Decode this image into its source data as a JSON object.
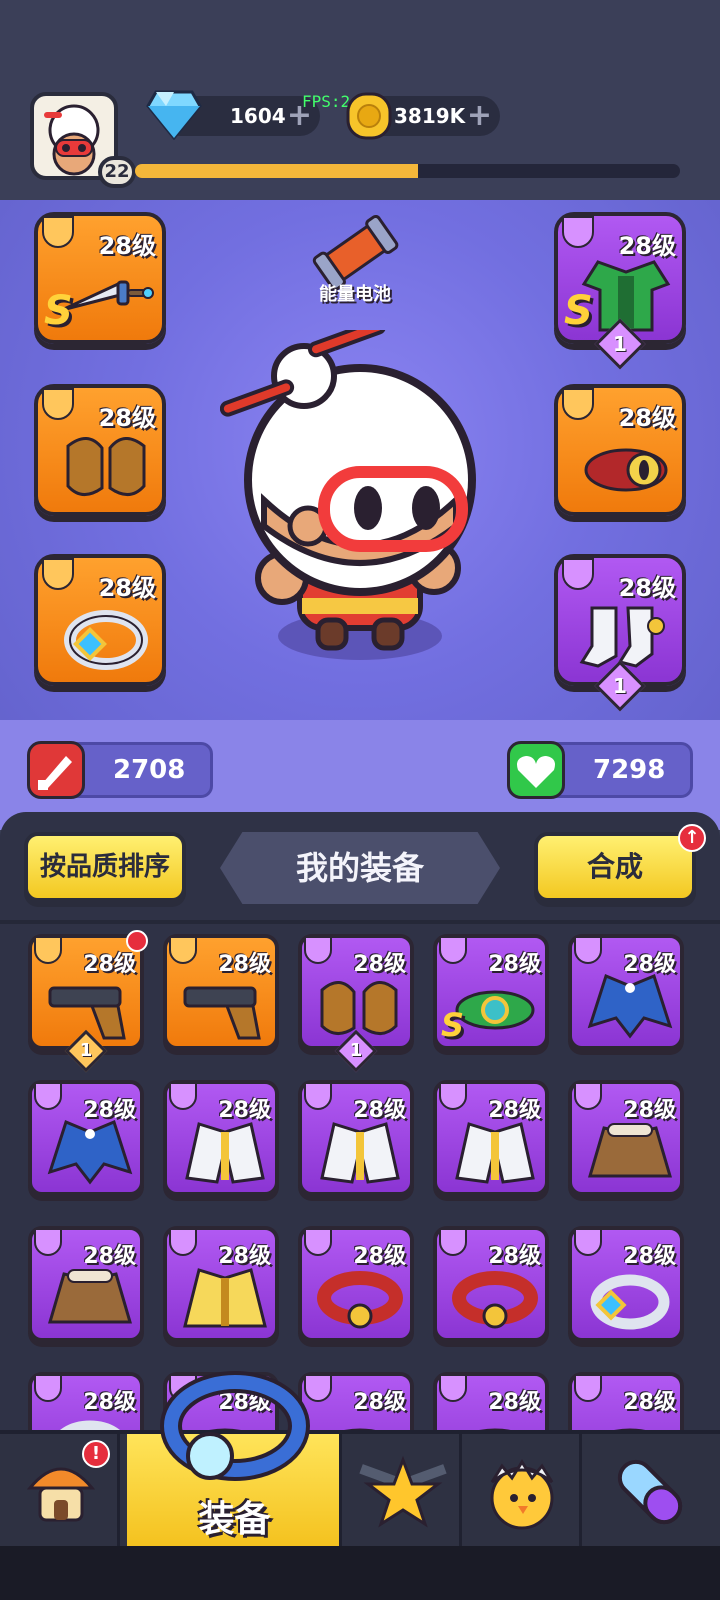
{
  "top_bar": {
    "player_level": "22",
    "gems": "1604",
    "coins": "3819K",
    "plus_symbol": "+",
    "fps_label": "FPS:24",
    "xp_progress": 0.52
  },
  "character_panel": {
    "battery_label": "能量电池",
    "slots": [
      {
        "level": "28级",
        "rarity": "orange",
        "rank": "S",
        "count": "",
        "icon": "sword-icon"
      },
      {
        "level": "28级",
        "rarity": "purple",
        "rank": "S",
        "count": "1",
        "icon": "armor-icon"
      },
      {
        "level": "28级",
        "rarity": "orange",
        "rank": "",
        "count": "",
        "icon": "gloves-icon"
      },
      {
        "level": "28级",
        "rarity": "orange",
        "rank": "",
        "count": "",
        "icon": "belt-icon"
      },
      {
        "level": "28级",
        "rarity": "orange",
        "rank": "",
        "count": "",
        "icon": "ring-icon"
      },
      {
        "level": "28级",
        "rarity": "purple",
        "rank": "",
        "count": "1",
        "icon": "boots-icon"
      }
    ],
    "attack": "2708",
    "health": "7298"
  },
  "inventory": {
    "sort_button": "按品质排序",
    "title": "我的装备",
    "merge_button": "合成",
    "merge_badge": "↑",
    "items": [
      {
        "level": "28级",
        "rarity": "orange",
        "rank": "",
        "count": "1",
        "icon": "gun-icon",
        "new": true
      },
      {
        "level": "28级",
        "rarity": "orange",
        "rank": "",
        "count": "",
        "icon": "gun-icon",
        "new": false
      },
      {
        "level": "28级",
        "rarity": "purple",
        "rank": "",
        "count": "1",
        "icon": "gloves-icon",
        "new": false
      },
      {
        "level": "28级",
        "rarity": "purple",
        "rank": "S",
        "count": "",
        "icon": "belt-icon",
        "new": false
      },
      {
        "level": "28级",
        "rarity": "purple",
        "rank": "",
        "count": "",
        "icon": "blue-coat-icon",
        "new": false
      },
      {
        "level": "28级",
        "rarity": "purple",
        "rank": "",
        "count": "",
        "icon": "blue-coat-icon",
        "new": false
      },
      {
        "level": "28级",
        "rarity": "purple",
        "rank": "",
        "count": "",
        "icon": "white-coat-icon",
        "new": false
      },
      {
        "level": "28级",
        "rarity": "purple",
        "rank": "",
        "count": "",
        "icon": "white-coat-icon",
        "new": false
      },
      {
        "level": "28级",
        "rarity": "purple",
        "rank": "",
        "count": "",
        "icon": "white-coat-icon",
        "new": false
      },
      {
        "level": "28级",
        "rarity": "purple",
        "rank": "",
        "count": "",
        "icon": "brown-jacket-icon",
        "new": false
      },
      {
        "level": "28级",
        "rarity": "purple",
        "rank": "",
        "count": "",
        "icon": "brown-jacket-icon",
        "new": false
      },
      {
        "level": "28级",
        "rarity": "purple",
        "rank": "",
        "count": "",
        "icon": "yellow-coat-icon",
        "new": false
      },
      {
        "level": "28级",
        "rarity": "purple",
        "rank": "",
        "count": "",
        "icon": "red-belt-icon",
        "new": false
      },
      {
        "level": "28级",
        "rarity": "purple",
        "rank": "",
        "count": "",
        "icon": "red-belt-icon",
        "new": false
      },
      {
        "level": "28级",
        "rarity": "purple",
        "rank": "",
        "count": "",
        "icon": "ring-icon",
        "new": false
      },
      {
        "level": "28级",
        "rarity": "purple",
        "rank": "",
        "count": "",
        "icon": "ring-icon",
        "new": false
      },
      {
        "level": "28级",
        "rarity": "purple",
        "rank": "",
        "count": "",
        "icon": "belt-icon",
        "new": false
      },
      {
        "level": "28级",
        "rarity": "purple",
        "rank": "",
        "count": "",
        "icon": "belt-icon",
        "new": false
      },
      {
        "level": "28级",
        "rarity": "purple",
        "rank": "",
        "count": "",
        "icon": "belt-icon",
        "new": false
      },
      {
        "level": "28级",
        "rarity": "purple",
        "rank": "",
        "count": "",
        "icon": "belt-icon",
        "new": false
      }
    ]
  },
  "bottom_nav": {
    "tabs": [
      {
        "name": "shop-tab",
        "icon": "mushroom-house-icon",
        "badge": "!"
      },
      {
        "name": "equipment-tab",
        "icon": "blue-ring-icon",
        "label": "装备",
        "active": true
      },
      {
        "name": "battle-tab",
        "icon": "star-guns-icon"
      },
      {
        "name": "pet-tab",
        "icon": "hatching-chick-icon"
      },
      {
        "name": "item-tab",
        "icon": "capsule-pill-icon"
      }
    ]
  },
  "colors": {
    "orange_rarity": "#f48a1a",
    "purple_rarity": "#9f45e0",
    "panel_bg": "#726fe0",
    "accent_yellow": "#f6d63a"
  }
}
